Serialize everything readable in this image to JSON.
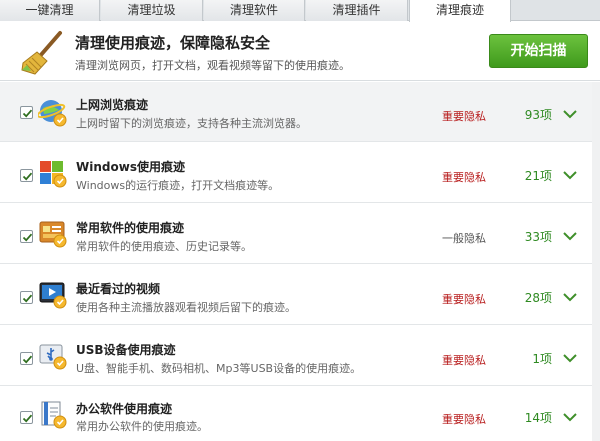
{
  "tabs": [
    {
      "label": "一键清理",
      "active": false
    },
    {
      "label": "清理垃圾",
      "active": false
    },
    {
      "label": "清理软件",
      "active": false
    },
    {
      "label": "清理插件",
      "active": false
    },
    {
      "label": "清理痕迹",
      "active": true
    }
  ],
  "header": {
    "title": "清理使用痕迹，保障隐私安全",
    "subtitle": "清理浏览网页，打开文档，观看视频等留下的使用痕迹。",
    "scan_button": "开始扫描",
    "icon": "broom-icon"
  },
  "items": [
    {
      "title": "上网浏览痕迹",
      "desc": "上网时留下的浏览痕迹，支持各种主流浏览器。",
      "tag": "重要隐私",
      "tag_level": "important",
      "count": "93项",
      "checked": true,
      "icon": "browser-icon"
    },
    {
      "title": "Windows使用痕迹",
      "desc": "Windows的运行痕迹，打开文档痕迹等。",
      "tag": "重要隐私",
      "tag_level": "important",
      "count": "21项",
      "checked": true,
      "icon": "windows-icon"
    },
    {
      "title": "常用软件的使用痕迹",
      "desc": "常用软件的使用痕迹、历史记录等。",
      "tag": "一般隐私",
      "tag_level": "normal",
      "count": "33项",
      "checked": true,
      "icon": "software-icon"
    },
    {
      "title": "最近看过的视频",
      "desc": "使用各种主流播放器观看视频后留下的痕迹。",
      "tag": "重要隐私",
      "tag_level": "important",
      "count": "28项",
      "checked": true,
      "icon": "video-icon"
    },
    {
      "title": "USB设备使用痕迹",
      "desc": "U盘、智能手机、数码相机、Mp3等USB设备的使用痕迹。",
      "tag": "重要隐私",
      "tag_level": "important",
      "count": "1项",
      "checked": true,
      "icon": "usb-icon"
    },
    {
      "title": "办公软件使用痕迹",
      "desc": "常用办公软件的使用痕迹。",
      "tag": "重要隐私",
      "tag_level": "important",
      "count": "14项",
      "checked": true,
      "icon": "office-icon"
    }
  ],
  "colors": {
    "important": "#b81d1d",
    "normal": "#555555",
    "count": "#2f8a22",
    "scan_button": "#4fa82a"
  }
}
